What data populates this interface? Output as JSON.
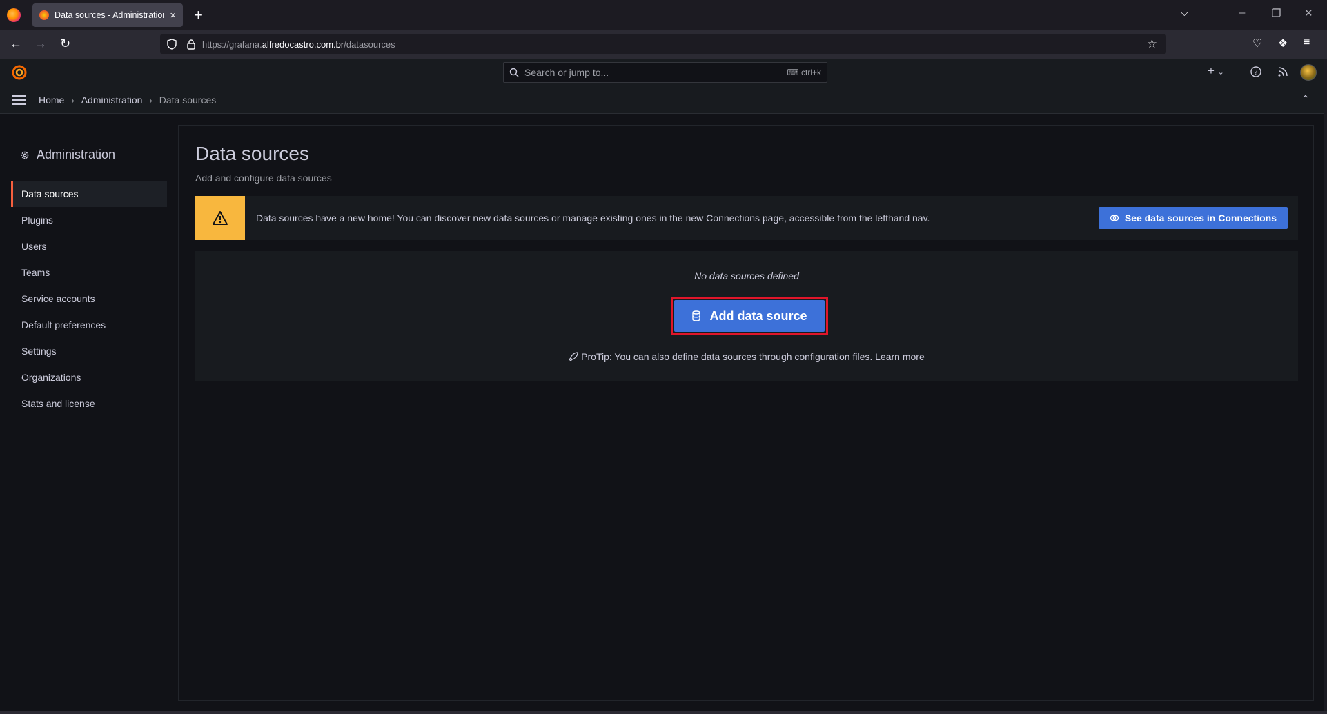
{
  "browser": {
    "tab_title": "Data sources - Administration - Grafana",
    "tab_close": "×",
    "new_tab": "+",
    "url_prefix": "https://grafana.",
    "url_domain": "alfredocastro.com.br",
    "url_path": "/datasources"
  },
  "topbar": {
    "search_placeholder": "Search or jump to...",
    "search_shortcut": "ctrl+k",
    "plus_label": "+"
  },
  "breadcrumb": {
    "items": [
      "Home",
      "Administration"
    ],
    "current": "Data sources"
  },
  "sidebar": {
    "title": "Administration",
    "items": [
      {
        "label": "Data sources",
        "active": true
      },
      {
        "label": "Plugins"
      },
      {
        "label": "Users"
      },
      {
        "label": "Teams"
      },
      {
        "label": "Service accounts"
      },
      {
        "label": "Default preferences"
      },
      {
        "label": "Settings"
      },
      {
        "label": "Organizations"
      },
      {
        "label": "Stats and license"
      }
    ]
  },
  "page": {
    "title": "Data sources",
    "subtitle": "Add and configure data sources",
    "alert_text": "Data sources have a new home! You can discover new data sources or manage existing ones in the new Connections page, accessible from the lefthand nav.",
    "alert_button": "See data sources in Connections",
    "empty_title": "No data sources defined",
    "add_button": "Add data source",
    "protip": "ProTip: You can also define data sources through configuration files.",
    "learn_more": "Learn more"
  },
  "colors": {
    "accent_blue": "#3d71d9",
    "warning": "#f8b73e",
    "highlight_border": "#e0162a",
    "active_marker": "#f55f3e"
  },
  "icons": [
    "firefox-logo",
    "grafana-logo",
    "search-icon",
    "keyboard-icon",
    "help-icon",
    "news-icon",
    "warning-icon",
    "database-icon",
    "rocket-icon",
    "connections-icon",
    "gear-icon"
  ]
}
